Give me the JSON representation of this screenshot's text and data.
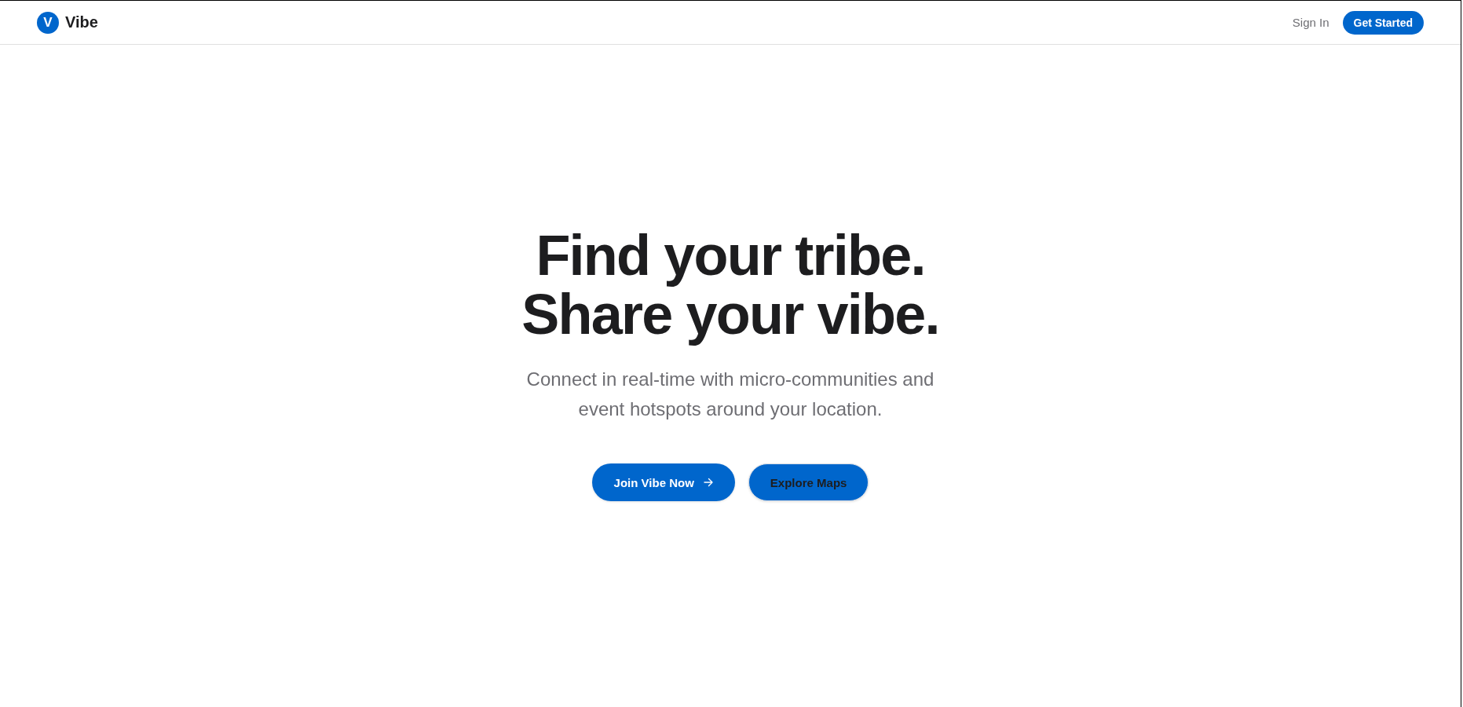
{
  "header": {
    "logo": {
      "mark": "V",
      "name": "Vibe"
    },
    "nav": [
      {
        "label": "Sign In",
        "kind": "link"
      },
      {
        "label": "Get Started",
        "kind": "primary"
      }
    ]
  },
  "hero": {
    "headline": [
      "Find your tribe.",
      "Share your vibe."
    ],
    "subtitle": "Connect in real-time with micro-communities and event hotspots around your location.",
    "actions": [
      {
        "label": "Join Vibe Now",
        "kind": "primary",
        "arrow": true
      },
      {
        "label": "Explore Maps",
        "kind": "secondary",
        "arrow": false
      }
    ]
  }
}
